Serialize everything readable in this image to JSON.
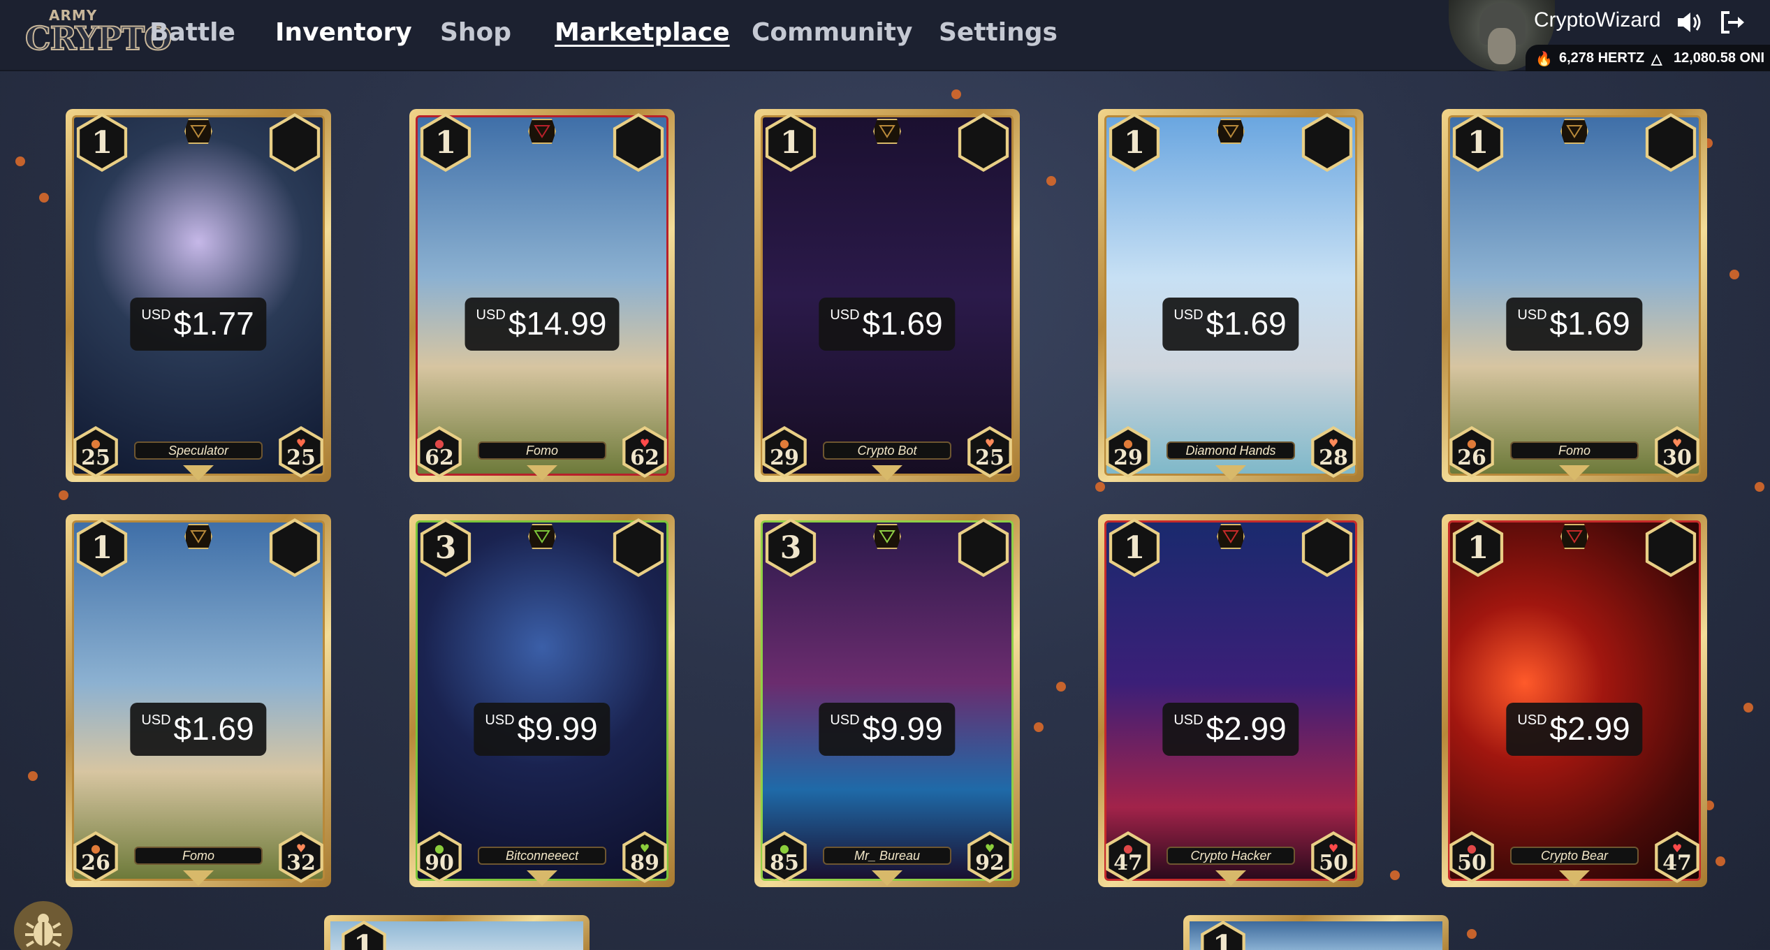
{
  "app": {
    "logo_top": "ARMY",
    "logo_main": "CRYPTO"
  },
  "nav": {
    "items": [
      "Battle",
      "Inventory",
      "Shop",
      "Marketplace",
      "Community",
      "Settings"
    ],
    "active": "Marketplace"
  },
  "user": {
    "name": "CryptoWizard",
    "hertz": "6,278 HERTZ",
    "onix": "12,080.58 ONI"
  },
  "icons": {
    "sound": "speaker-icon",
    "logout": "logout-icon",
    "hertz": "hertz-icon",
    "onix": "onix-triangle-icon",
    "bug": "bug-icon"
  },
  "colors": {
    "background": "#2b3349",
    "topbar": "#1c2130",
    "gold": "#e9cf86",
    "spark": "#d8692a"
  },
  "cards": [
    {
      "level": "1",
      "currency": "USD",
      "price": "$1.77",
      "name": "Speculator",
      "attack": "25",
      "health": "25",
      "theme": "speculator",
      "attack_color": "#e07b39",
      "health_color": "#ff6a4a"
    },
    {
      "level": "1",
      "currency": "USD",
      "price": "$14.99",
      "name": "Fomo",
      "attack": "62",
      "health": "62",
      "theme": "fomo-red",
      "attack_color": "#e04848",
      "health_color": "#ff4a4a"
    },
    {
      "level": "1",
      "currency": "USD",
      "price": "$1.69",
      "name": "Crypto Bot",
      "attack": "29",
      "health": "25",
      "theme": "bot",
      "attack_color": "#e07b39",
      "health_color": "#ff8a5a"
    },
    {
      "level": "1",
      "currency": "USD",
      "price": "$1.69",
      "name": "Diamond Hands",
      "attack": "29",
      "health": "28",
      "theme": "diamond",
      "attack_color": "#e07b39",
      "health_color": "#ff8a5a"
    },
    {
      "level": "1",
      "currency": "USD",
      "price": "$1.69",
      "name": "Fomo",
      "attack": "26",
      "health": "30",
      "theme": "fomo",
      "attack_color": "#e07b39",
      "health_color": "#ff8a5a"
    },
    {
      "level": "1",
      "currency": "USD",
      "price": "$1.69",
      "name": "Fomo",
      "attack": "26",
      "health": "32",
      "theme": "fomo",
      "attack_color": "#e07b39",
      "health_color": "#ff8a5a"
    },
    {
      "level": "3",
      "currency": "USD",
      "price": "$9.99",
      "name": "Bitconneeect",
      "attack": "90",
      "health": "89",
      "theme": "bitconnect",
      "attack_color": "#8ccf3c",
      "health_color": "#8ccf3c"
    },
    {
      "level": "3",
      "currency": "USD",
      "price": "$9.99",
      "name": "Mr_ Bureau",
      "attack": "85",
      "health": "92",
      "theme": "bureau",
      "attack_color": "#8ccf3c",
      "health_color": "#8ccf3c"
    },
    {
      "level": "1",
      "currency": "USD",
      "price": "$2.99",
      "name": "Crypto Hacker",
      "attack": "47",
      "health": "50",
      "theme": "hacker",
      "attack_color": "#e04848",
      "health_color": "#ff4a4a"
    },
    {
      "level": "1",
      "currency": "USD",
      "price": "$2.99",
      "name": "Crypto Bear",
      "attack": "50",
      "health": "47",
      "theme": "bear",
      "attack_color": "#e04848",
      "health_color": "#ff4a4a"
    }
  ],
  "partial_cards": [
    {
      "level": "1"
    },
    {
      "level": "1"
    }
  ]
}
